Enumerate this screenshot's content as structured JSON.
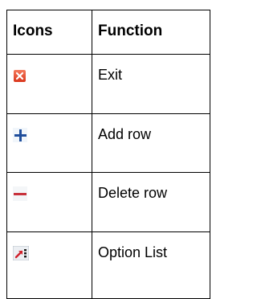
{
  "table": {
    "headers": {
      "icons": "Icons",
      "function": "Function"
    },
    "rows": [
      {
        "icon": "exit-icon",
        "function": "Exit"
      },
      {
        "icon": "add-row-icon",
        "function": "Add row"
      },
      {
        "icon": "delete-row-icon",
        "function": "Delete row"
      },
      {
        "icon": "option-list-icon",
        "function": "Option List"
      }
    ]
  },
  "colors": {
    "border": "#000000",
    "exit_icon": "#e8472b",
    "add_icon": "#1f4e9c",
    "delete_icon": "#c8323c",
    "option_icon": "#d0202a"
  }
}
